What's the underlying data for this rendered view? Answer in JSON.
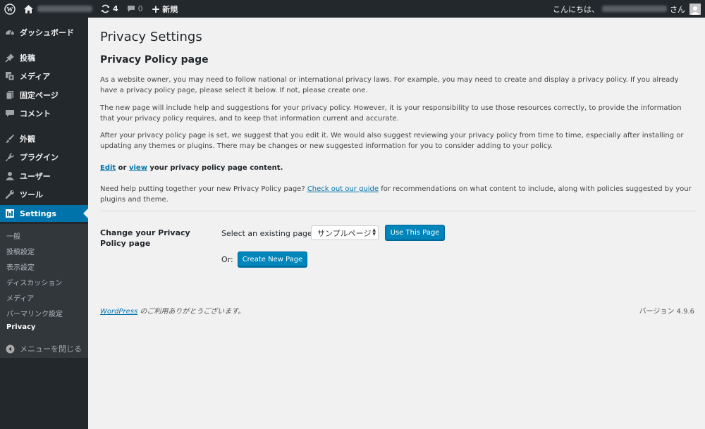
{
  "adminbar": {
    "updates_count": "4",
    "comments_count": "0",
    "new_label": "新規",
    "greeting": "こんにちは、",
    "greeting_suffix": "さん"
  },
  "sidebar": {
    "items": [
      {
        "label": "ダッシュボード",
        "icon": "dashboard-icon"
      },
      {
        "label": "投稿",
        "icon": "pin-icon"
      },
      {
        "label": "メディア",
        "icon": "media-icon"
      },
      {
        "label": "固定ページ",
        "icon": "page-icon"
      },
      {
        "label": "コメント",
        "icon": "comment-icon"
      },
      {
        "label": "外観",
        "icon": "brush-icon"
      },
      {
        "label": "プラグイン",
        "icon": "plugin-icon"
      },
      {
        "label": "ユーザー",
        "icon": "user-icon"
      },
      {
        "label": "ツール",
        "icon": "wrench-icon"
      },
      {
        "label": "Settings",
        "icon": "settings-icon"
      }
    ],
    "submenu": [
      "一般",
      "投稿設定",
      "表示設定",
      "ディスカッション",
      "メディア",
      "パーマリンク設定",
      "Privacy"
    ],
    "collapse_label": "メニューを閉じる"
  },
  "main": {
    "page_title": "Privacy Settings",
    "section_title": "Privacy Policy page",
    "para1": "As a website owner, you may need to follow national or international privacy laws. For example, you may need to create and display a privacy policy. If you already have a privacy policy page, please select it below. If not, please create one.",
    "para2": "The new page will include help and suggestions for your privacy policy. However, it is your responsibility to use those resources correctly, to provide the information that your privacy policy requires, and to keep that information current and accurate.",
    "para3": "After your privacy policy page is set, we suggest that you edit it. We would also suggest reviewing your privacy policy from time to time, especially after installing or updating any themes or plugins. There may be changes or new suggested information for you to consider adding to your policy.",
    "edit_link": "Edit",
    "or_word": " or ",
    "view_link": "view",
    "edit_tail": " your privacy policy page content.",
    "help_prefix": "Need help putting together your new Privacy Policy page? ",
    "guide_link": "Check out our guide",
    "help_suffix": " for recommendations on what content to include, along with policies suggested by your plugins and theme.",
    "form_label": "Change your Privacy Policy page",
    "select_label": "Select an existing page:",
    "select_value": "サンプルページ",
    "use_button": "Use This Page",
    "or_label": "Or:",
    "create_button": "Create New Page"
  },
  "footer": {
    "wp_link": "WordPress",
    "thanks": " のご利用ありがとうございます。",
    "version": "バージョン 4.9.6"
  }
}
